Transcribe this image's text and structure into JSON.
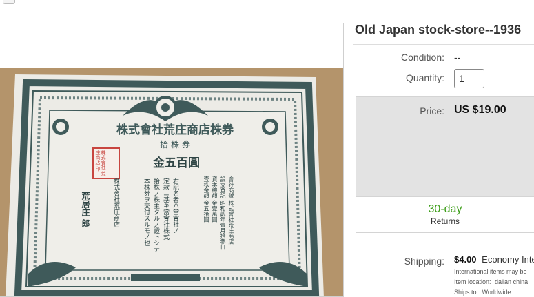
{
  "listing": {
    "title": "Old Japan stock-store--1936"
  },
  "condition": {
    "label": "Condition:",
    "value": "--"
  },
  "quantity": {
    "label": "Quantity:",
    "value": "1"
  },
  "price": {
    "label": "Price:",
    "value": "US $19.00"
  },
  "returns": {
    "days": "30-day",
    "label": "Returns"
  },
  "shipping": {
    "label": "Shipping:",
    "cost": "$4.00",
    "method": "Economy Inte",
    "intl_note": "International items may be",
    "location_label": "Item location:",
    "location": "dalian china",
    "ships_to_label": "Ships to:",
    "ships_to": "Worldwide"
  },
  "certificate": {
    "header": "株式會社荒庄商店株券",
    "sub": "拾株券",
    "amount": "金五百圓",
    "seal": "株式會社 荒庄商店 印",
    "company": "株式會社荒庄商店",
    "signer": "荒居庄 郎",
    "col1": "右記名者ハ當會社ノ",
    "col2": "定款ニ基キ當會社株式",
    "col3": "拾株ノ株主タルノ證トシテ",
    "col4": "本株券ヲ交付スルモノ也",
    "info1": "會社商號 株式會社荒庄商店",
    "info2": "設立登記 昭和貳年壹月拾參日",
    "info3": "資本總額 金壹萬圓",
    "info4": "壹株金額 金五拾圓"
  },
  "colors": {
    "returns_green": "#3b9d17",
    "price_bg": "#e3e3e3",
    "certificate_ink": "#3f5a5a",
    "seal_red": "#c8453f"
  }
}
